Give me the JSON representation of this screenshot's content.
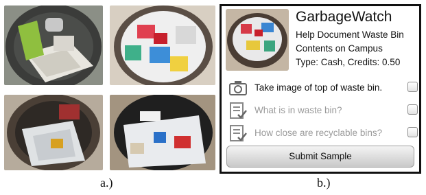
{
  "captions": {
    "a": "a.)",
    "b": "b.)"
  },
  "photos": [
    {
      "icon": "waste-bin-photo"
    },
    {
      "icon": "waste-bin-photo"
    },
    {
      "icon": "waste-bin-photo"
    },
    {
      "icon": "waste-bin-photo"
    }
  ],
  "app": {
    "title": "GarbageWatch",
    "description_line1": "Help Document Waste Bin",
    "description_line2": "Contents on Campus",
    "type_line": "Type: Cash, Credits: 0.50",
    "tasks": [
      {
        "label": "Take image of top of waste bin.",
        "icon": "camera-icon",
        "enabled": true,
        "checked": false
      },
      {
        "label": "What is in waste bin?",
        "icon": "checklist-icon",
        "enabled": false,
        "checked": false
      },
      {
        "label": "How close are recyclable bins?",
        "icon": "checklist-icon",
        "enabled": false,
        "checked": false
      }
    ],
    "submit_label": "Submit Sample"
  },
  "colors": {
    "enabled_text": "#111111",
    "disabled_text": "#9a9a9a",
    "frame": "#111111"
  }
}
